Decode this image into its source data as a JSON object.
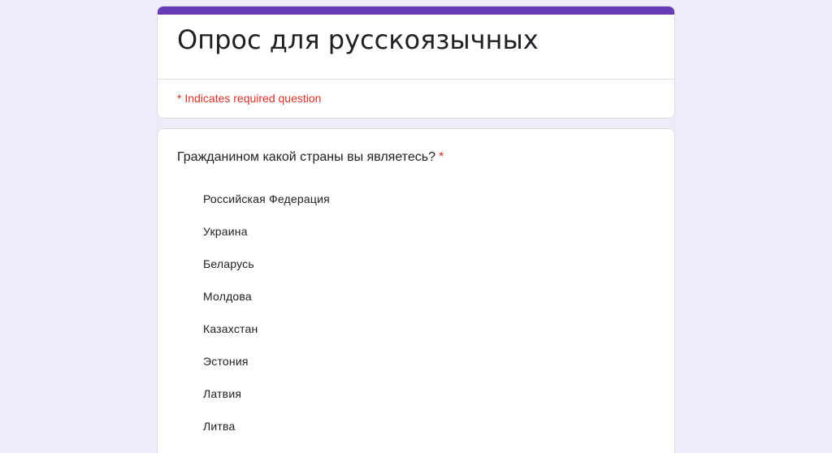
{
  "form": {
    "title": "Опрос для русскоязычных",
    "required_note": "* Indicates required question",
    "accent_color": "#673ab7"
  },
  "question": {
    "text": "Гражданином какой страны вы являетесь?",
    "required_marker": "*",
    "options": [
      {
        "label": "Российская Федерация"
      },
      {
        "label": "Украина"
      },
      {
        "label": "Беларусь"
      },
      {
        "label": "Молдова"
      },
      {
        "label": "Казахстан"
      },
      {
        "label": "Эстония"
      },
      {
        "label": "Латвия"
      },
      {
        "label": "Литва"
      }
    ]
  }
}
